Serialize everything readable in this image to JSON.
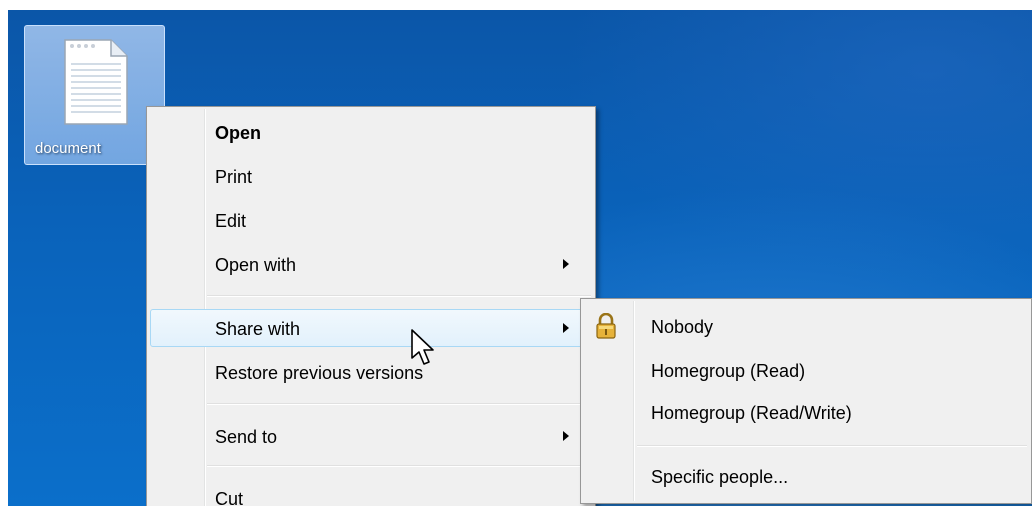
{
  "desktop": {
    "file_label": "document",
    "file_icon": "text-document-icon"
  },
  "context_menu": {
    "items": [
      {
        "label": "Open",
        "bold": true
      },
      {
        "label": "Print"
      },
      {
        "label": "Edit"
      },
      {
        "label": "Open with",
        "submenu": true
      },
      {
        "label": "Share with",
        "submenu": true,
        "highlighted": true
      },
      {
        "label": "Restore previous versions"
      },
      {
        "label": "Send to",
        "submenu": true
      },
      {
        "label": "Cut"
      }
    ]
  },
  "share_submenu": {
    "items": [
      {
        "label": "Nobody",
        "icon": "lock-icon"
      },
      {
        "label": "Homegroup (Read)"
      },
      {
        "label": "Homegroup (Read/Write)"
      },
      {
        "label": "Specific people..."
      }
    ]
  },
  "cursor": "arrow-cursor-icon"
}
